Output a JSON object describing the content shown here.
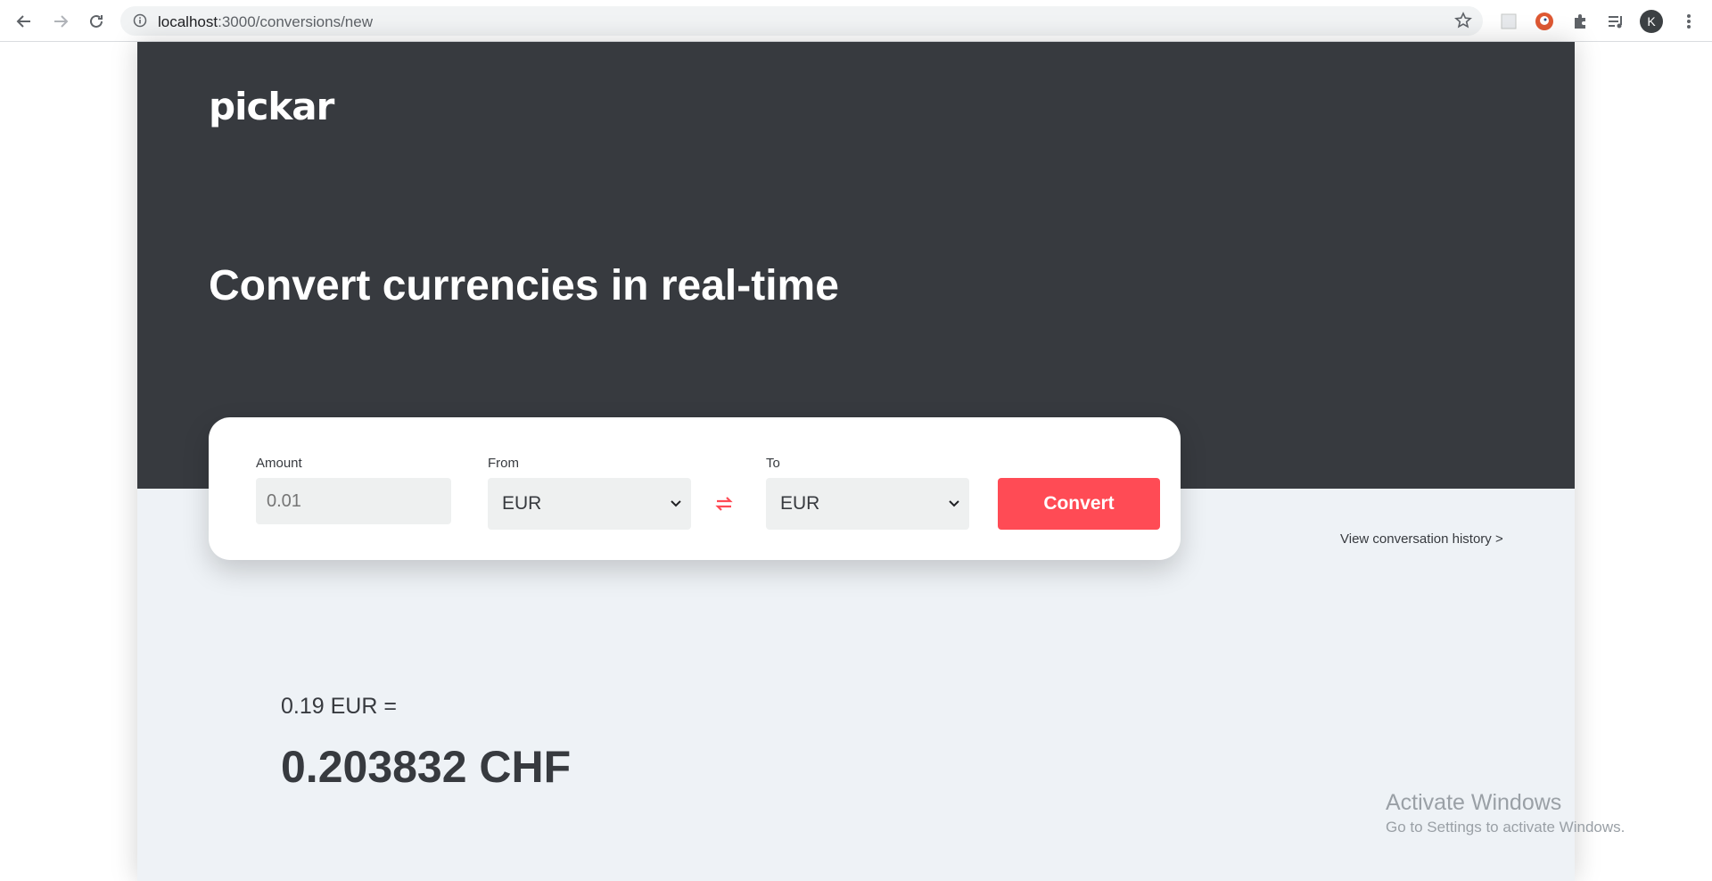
{
  "browser": {
    "url_host": "localhost",
    "url_path": ":3000/conversions/new",
    "avatar_initial": "K"
  },
  "header": {
    "logo_text": "pickar",
    "headline": "Convert currencies in real-time"
  },
  "form": {
    "amount_label": "Amount",
    "amount_placeholder": "0.01",
    "from_label": "From",
    "from_value": "EUR",
    "to_label": "To",
    "to_value": "EUR",
    "convert_label": "Convert"
  },
  "links": {
    "history": "View conversation history >"
  },
  "result": {
    "from_text": "0.19 EUR =",
    "to_text": "0.203832 CHF"
  },
  "watermark": {
    "title": "Activate Windows",
    "subtitle": "Go to Settings to activate Windows."
  },
  "colors": {
    "hero_bg": "#373a3f",
    "accent": "#ff4b55",
    "page_bg": "#eef2f6"
  }
}
